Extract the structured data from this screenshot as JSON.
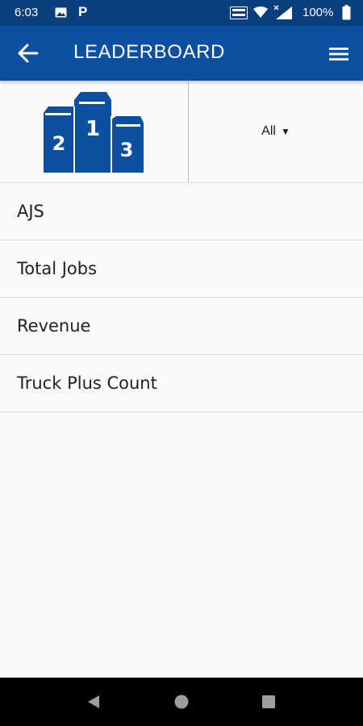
{
  "status_bar": {
    "time": "6:03",
    "battery": "100%",
    "icons": [
      "photo-icon",
      "p-icon",
      "volte-icon",
      "wifi-icon",
      "signal-icon",
      "battery-icon"
    ]
  },
  "app_bar": {
    "title": "LEADERBOARD",
    "back_icon": "arrow-left-icon",
    "menu_icon": "hamburger-menu-icon"
  },
  "header": {
    "podium_icon": "podium-icon",
    "filter_value": "All",
    "filter_arrow": "▼"
  },
  "list": {
    "items": [
      {
        "label": "AJS"
      },
      {
        "label": "Total Jobs"
      },
      {
        "label": "Revenue"
      },
      {
        "label": "Truck Plus Count"
      }
    ]
  },
  "nav_bar": {
    "icons": [
      "nav-back-icon",
      "nav-home-icon",
      "nav-recents-icon"
    ]
  },
  "colors": {
    "status_bar": "#0a3e7e",
    "app_bar": "#0d4fa0",
    "podium": "#0d4fa0",
    "background": "#fafafa"
  }
}
